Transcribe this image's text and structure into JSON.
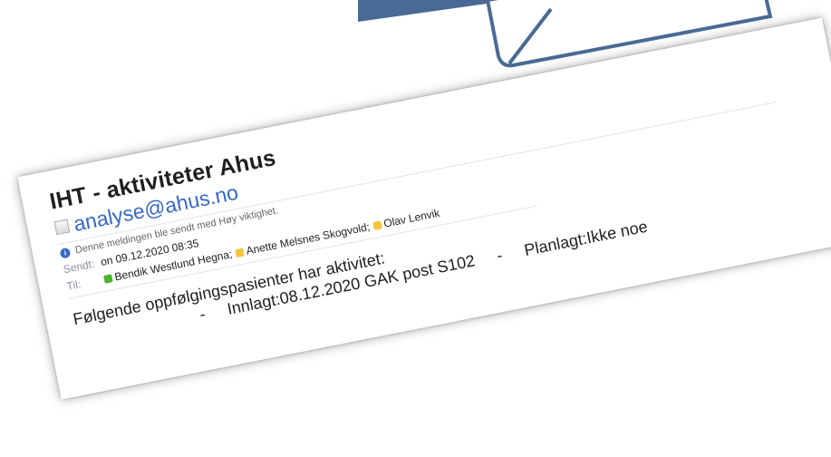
{
  "email": {
    "subject": "IHT - aktiviteter Ahus",
    "sender": "analyse@ahus.no",
    "importance_note": "Denne meldingen ble sendt med Høy viktighet.",
    "sent_label": "Sendt:",
    "sent_value": "on 09.12.2020 08:35",
    "to_label": "Til:",
    "recipients": [
      {
        "name": "Bendik Westlund Hegna",
        "status": "green",
        "separator": ";"
      },
      {
        "name": "Anette Melsnes Skogvold",
        "status": "yellow",
        "separator": ";"
      },
      {
        "name": "Olav Lenvik",
        "status": "yellow",
        "separator": ""
      }
    ],
    "body_line_1": "Følgende oppfølgingspasienter har aktivitet:",
    "body_line_2": "-     Innlagt:08.12.2020 GAK post S102     -     Planlagt:Ikke noe"
  },
  "colors": {
    "sender_link": "#3767c8",
    "envelope": "#4a6a95",
    "info_icon": "#3a6cc2"
  }
}
